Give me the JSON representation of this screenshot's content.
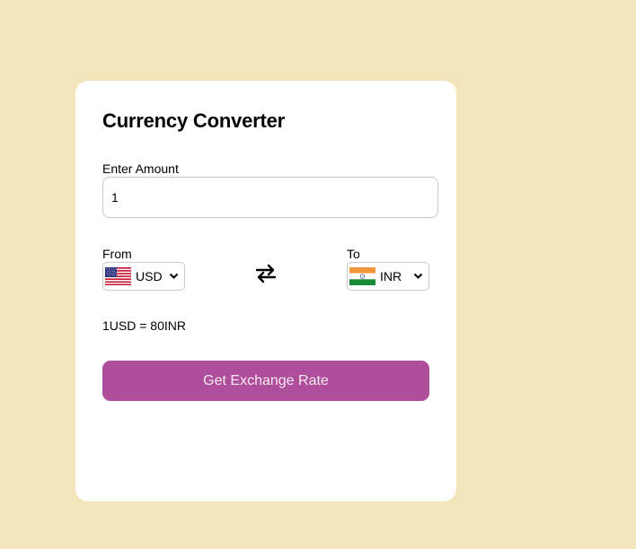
{
  "converter": {
    "title": "Currency Converter",
    "amount_label": "Enter Amount",
    "amount_value": "1",
    "from_label": "From",
    "to_label": "To",
    "from_currency": {
      "code": "USD",
      "flag_icon": "us-flag-icon"
    },
    "to_currency": {
      "code": "INR",
      "flag_icon": "india-flag-icon"
    },
    "swap_icon": "swap-arrows-icon",
    "rate_text": "1USD = 80INR",
    "button_label": "Get Exchange Rate"
  },
  "colors": {
    "page_background": "#f2e4bb",
    "card_background": "#ffffff",
    "button_background": "#af4f9b",
    "button_text": "#f7e9f3"
  }
}
